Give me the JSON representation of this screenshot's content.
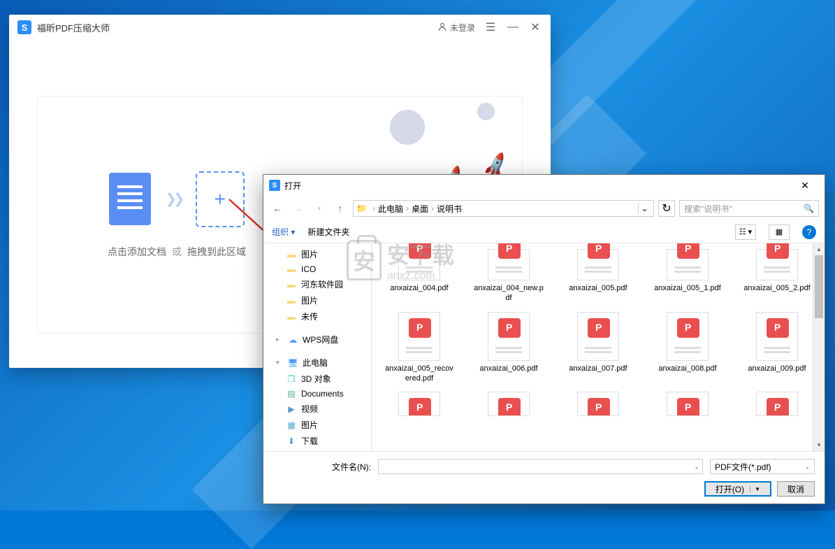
{
  "app": {
    "title": "福昕PDF压缩大师",
    "login": "未登录",
    "drop_text_add": "点击添加文档",
    "drop_text_or": "或",
    "drop_text_drag": "拖拽到此区域"
  },
  "dialog": {
    "title": "打开",
    "breadcrumb": [
      "此电脑",
      "桌面",
      "说明书"
    ],
    "search_placeholder": "搜索\"说明书\"",
    "toolbar_org": "组织 ▾",
    "toolbar_new": "新建文件夹",
    "tree": [
      {
        "icon": "folder",
        "label": "图片",
        "level": 2,
        "chev": ""
      },
      {
        "icon": "folder",
        "label": "ICO",
        "level": 2,
        "chev": ""
      },
      {
        "icon": "folder",
        "label": "河东软件园",
        "level": 2,
        "chev": ""
      },
      {
        "icon": "folder",
        "label": "图片",
        "level": 2,
        "chev": ""
      },
      {
        "icon": "folder",
        "label": "未传",
        "level": 2,
        "chev": ""
      },
      {
        "icon": "wps",
        "label": "WPS网盘",
        "level": 1,
        "chev": "▸"
      },
      {
        "icon": "pc",
        "label": "此电脑",
        "level": 1,
        "chev": "▾"
      },
      {
        "icon": "3d",
        "label": "3D 对象",
        "level": 2,
        "chev": ""
      },
      {
        "icon": "doc",
        "label": "Documents",
        "level": 2,
        "chev": ""
      },
      {
        "icon": "video",
        "label": "视频",
        "level": 2,
        "chev": ""
      },
      {
        "icon": "pic",
        "label": "图片",
        "level": 2,
        "chev": ""
      },
      {
        "icon": "dl",
        "label": "下载",
        "level": 2,
        "chev": ""
      }
    ],
    "files_row1": [
      "anxaizai_004.pdf",
      "anxaizai_004_new.pdf",
      "anxaizai_005.pdf",
      "anxaizai_005_1.pdf",
      "anxaizai_005_2.pdf"
    ],
    "files_row2": [
      "anxaizai_005_recovered.pdf",
      "anxaizai_006.pdf",
      "anxaizai_007.pdf",
      "anxaizai_008.pdf",
      "anxaizai_009.pdf"
    ],
    "filename_label": "文件名(N):",
    "filter": "PDF文件(*.pdf)",
    "open_btn": "打开(O)",
    "cancel_btn": "取消"
  },
  "watermark": "安下载",
  "watermark_sub": "anxz.com"
}
